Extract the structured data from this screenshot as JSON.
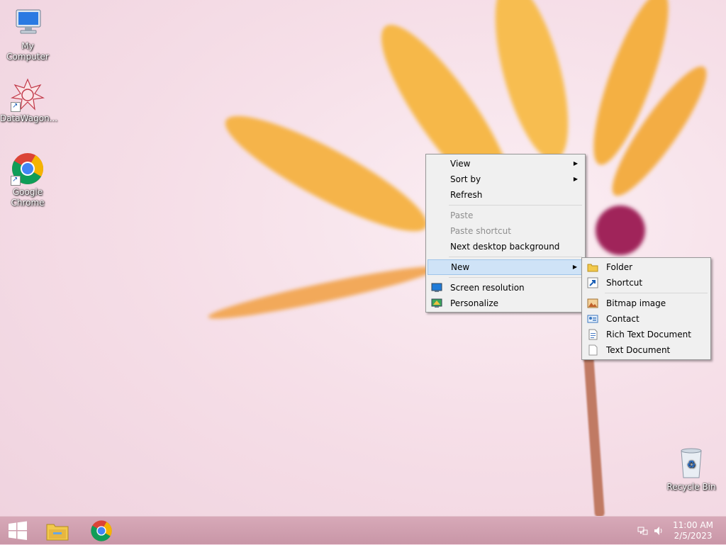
{
  "desktop": {
    "icons": [
      {
        "label": "My Computer",
        "icon": "computer-icon"
      },
      {
        "label": "DataWagon...",
        "icon": "datawagon-icon"
      },
      {
        "label": "Google Chrome",
        "icon": "chrome-icon"
      },
      {
        "label": "Recycle Bin",
        "icon": "recycle-bin-icon"
      }
    ]
  },
  "context_menu": {
    "items": [
      {
        "label": "View",
        "submenu": true
      },
      {
        "label": "Sort by",
        "submenu": true
      },
      {
        "label": "Refresh"
      },
      {
        "label": "Paste",
        "disabled": true
      },
      {
        "label": "Paste shortcut",
        "disabled": true
      },
      {
        "label": "Next desktop background"
      },
      {
        "label": "New",
        "submenu": true,
        "highlighted": true
      },
      {
        "label": "Screen resolution",
        "icon": "screen-resolution-icon"
      },
      {
        "label": "Personalize",
        "icon": "personalize-icon"
      }
    ]
  },
  "new_submenu": {
    "items": [
      {
        "label": "Folder",
        "icon": "folder-icon"
      },
      {
        "label": "Shortcut",
        "icon": "shortcut-icon"
      },
      {
        "label": "Bitmap image",
        "icon": "bitmap-icon"
      },
      {
        "label": "Contact",
        "icon": "contact-icon"
      },
      {
        "label": "Rich Text Document",
        "icon": "rich-text-icon"
      },
      {
        "label": "Text Document",
        "icon": "text-document-icon"
      }
    ]
  },
  "taskbar": {
    "time": "11:00 AM",
    "date": "2/5/2023"
  },
  "colors": {
    "menu_bg": "#f0f0f0",
    "menu_highlight": "#cfe3f7",
    "taskbar": "#cc9aab",
    "petal": "#f5b44a"
  }
}
